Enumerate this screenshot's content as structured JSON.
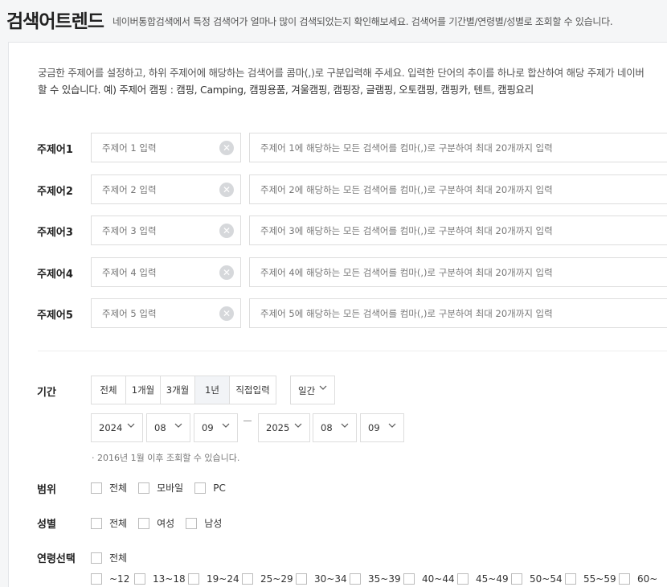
{
  "header": {
    "title": "검색어트렌드",
    "description": "네이버통합검색에서 특정 검색어가 얼마나 많이 검색되었는지 확인해보세요. 검색어를 기간별/연령별/성별로 조회할 수 있습니다."
  },
  "intro": {
    "line1": "궁금한 주제어를 설정하고, 하위 주제어에 해당하는 검색어를 콤마(,)로 구분입력해 주세요. 입력한 단어의 추이를 하나로 합산하여 해당 주제가 네이버",
    "line2": "할 수 있습니다. 예) 주제어 캠핑 : 캠핑, Camping, 캠핑용품, 겨울캠핑, 캠핑장, 글램핑, 오토캠핑, 캠핑카, 텐트, 캠핑요리"
  },
  "topics": [
    {
      "label": "주제어1",
      "name_placeholder": "주제어 1 입력",
      "keywords_placeholder": "주제어 1에 해당하는 모든 검색어를 컴마(,)로 구분하여 최대 20개까지 입력"
    },
    {
      "label": "주제어2",
      "name_placeholder": "주제어 2 입력",
      "keywords_placeholder": "주제어 2에 해당하는 모든 검색어를 컴마(,)로 구분하여 최대 20개까지 입력"
    },
    {
      "label": "주제어3",
      "name_placeholder": "주제어 3 입력",
      "keywords_placeholder": "주제어 3에 해당하는 모든 검색어를 컴마(,)로 구분하여 최대 20개까지 입력"
    },
    {
      "label": "주제어4",
      "name_placeholder": "주제어 4 입력",
      "keywords_placeholder": "주제어 4에 해당하는 모든 검색어를 컴마(,)로 구분하여 최대 20개까지 입력"
    },
    {
      "label": "주제어5",
      "name_placeholder": "주제어 5 입력",
      "keywords_placeholder": "주제어 5에 해당하는 모든 검색어를 컴마(,)로 구분하여 최대 20개까지 입력"
    }
  ],
  "period": {
    "label": "기간",
    "buttons": [
      "전체",
      "1개월",
      "3개월",
      "1년",
      "직접입력"
    ],
    "active": "1년",
    "interval": "일간",
    "start": {
      "year": "2024",
      "month": "08",
      "day": "09"
    },
    "end": {
      "year": "2025",
      "month": "08",
      "day": "09"
    },
    "note": "· 2016년 1월 이후 조회할 수 있습니다."
  },
  "range": {
    "label": "범위",
    "options": [
      "전체",
      "모바일",
      "PC"
    ]
  },
  "gender": {
    "label": "성별",
    "options": [
      "전체",
      "여성",
      "남성"
    ]
  },
  "age": {
    "label": "연령선택",
    "all": "전체",
    "options": [
      "~12",
      "13~18",
      "19~24",
      "25~29",
      "30~34",
      "35~39",
      "40~44",
      "45~49",
      "50~54",
      "55~59",
      "60~"
    ]
  },
  "icons": {
    "clear": "clear-circle-icon",
    "dropdown": "chevron-down-icon"
  }
}
